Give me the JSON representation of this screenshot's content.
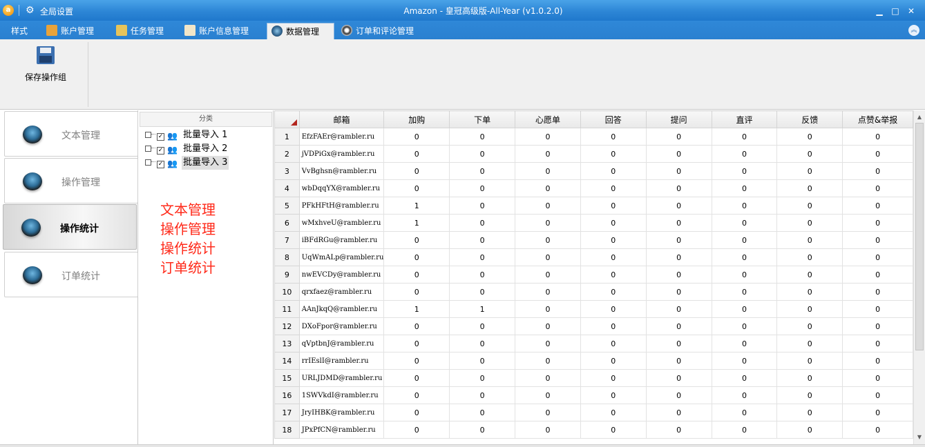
{
  "window": {
    "title": "Amazon - 皇冠高级版-All-Year  (v1.0.2.0)",
    "global_settings": "全局设置",
    "app_icon_glyph": "a",
    "minimize": "▁",
    "maximize": "□",
    "close": "✕"
  },
  "tabs": [
    {
      "label": "样式",
      "icon": "none",
      "active": false
    },
    {
      "label": "账户管理",
      "icon": "users-icon",
      "active": false
    },
    {
      "label": "任务管理",
      "icon": "clipboard-icon",
      "active": false
    },
    {
      "label": "账户信息管理",
      "icon": "document-icon",
      "active": false
    },
    {
      "label": "数据管理",
      "icon": "disc-icon",
      "active": true
    },
    {
      "label": "订单和评论管理",
      "icon": "eye-icon",
      "active": false
    }
  ],
  "ribbon": {
    "save_label": "保存操作组",
    "collapse_glyph": "︽"
  },
  "nav": [
    {
      "label": "文本管理",
      "active": false
    },
    {
      "label": "操作管理",
      "active": false
    },
    {
      "label": "操作统计",
      "active": true
    },
    {
      "label": "订单统计",
      "active": false
    }
  ],
  "tree": {
    "header": "分类",
    "items": [
      {
        "label": "批量导入 1",
        "checked": "✓"
      },
      {
        "label": "批量导入 2",
        "checked": "✓"
      },
      {
        "label": "批量导入 3",
        "checked": "✓"
      }
    ]
  },
  "annotation_lines": [
    "文本管理",
    "操作管理",
    "操作统计",
    "订单统计"
  ],
  "grid": {
    "columns": [
      "邮箱",
      "加购",
      "下单",
      "心愿单",
      "回答",
      "提问",
      "直评",
      "反馈",
      "点赞&举报"
    ],
    "rows": [
      [
        "1",
        "EfzFAEr@rambler.ru",
        "0",
        "0",
        "0",
        "0",
        "0",
        "0",
        "0",
        "0"
      ],
      [
        "2",
        "jVDPiGx@rambler.ru",
        "0",
        "0",
        "0",
        "0",
        "0",
        "0",
        "0",
        "0"
      ],
      [
        "3",
        "VvBghsn@rambler.ru",
        "0",
        "0",
        "0",
        "0",
        "0",
        "0",
        "0",
        "0"
      ],
      [
        "4",
        "wbDqqYX@rambler.ru",
        "0",
        "0",
        "0",
        "0",
        "0",
        "0",
        "0",
        "0"
      ],
      [
        "5",
        "PFkHFtH@rambler.ru",
        "1",
        "0",
        "0",
        "0",
        "0",
        "0",
        "0",
        "0"
      ],
      [
        "6",
        "wMxhveU@rambler.ru",
        "1",
        "0",
        "0",
        "0",
        "0",
        "0",
        "0",
        "0"
      ],
      [
        "7",
        "iBFdRGu@rambler.ru",
        "0",
        "0",
        "0",
        "0",
        "0",
        "0",
        "0",
        "0"
      ],
      [
        "8",
        "UqWmALp@rambler.ru",
        "0",
        "0",
        "0",
        "0",
        "0",
        "0",
        "0",
        "0"
      ],
      [
        "9",
        "nwEVCDy@rambler.ru",
        "0",
        "0",
        "0",
        "0",
        "0",
        "0",
        "0",
        "0"
      ],
      [
        "10",
        "qrxfaez@rambler.ru",
        "0",
        "0",
        "0",
        "0",
        "0",
        "0",
        "0",
        "0"
      ],
      [
        "11",
        "AAnJkqQ@rambler.ru",
        "1",
        "1",
        "0",
        "0",
        "0",
        "0",
        "0",
        "0"
      ],
      [
        "12",
        "DXoFpor@rambler.ru",
        "0",
        "0",
        "0",
        "0",
        "0",
        "0",
        "0",
        "0"
      ],
      [
        "13",
        "qVptbnJ@rambler.ru",
        "0",
        "0",
        "0",
        "0",
        "0",
        "0",
        "0",
        "0"
      ],
      [
        "14",
        "rrIEslI@rambler.ru",
        "0",
        "0",
        "0",
        "0",
        "0",
        "0",
        "0",
        "0"
      ],
      [
        "15",
        "URLJDMD@rambler.ru",
        "0",
        "0",
        "0",
        "0",
        "0",
        "0",
        "0",
        "0"
      ],
      [
        "16",
        "1SWVkdI@rambler.ru",
        "0",
        "0",
        "0",
        "0",
        "0",
        "0",
        "0",
        "0"
      ],
      [
        "17",
        "JryIHBK@rambler.ru",
        "0",
        "0",
        "0",
        "0",
        "0",
        "0",
        "0",
        "0"
      ],
      [
        "18",
        "JPxPfCN@rambler.ru",
        "0",
        "0",
        "0",
        "0",
        "0",
        "0",
        "0",
        "0"
      ]
    ]
  },
  "scrollbar": {
    "up": "▲",
    "down": "▼"
  }
}
